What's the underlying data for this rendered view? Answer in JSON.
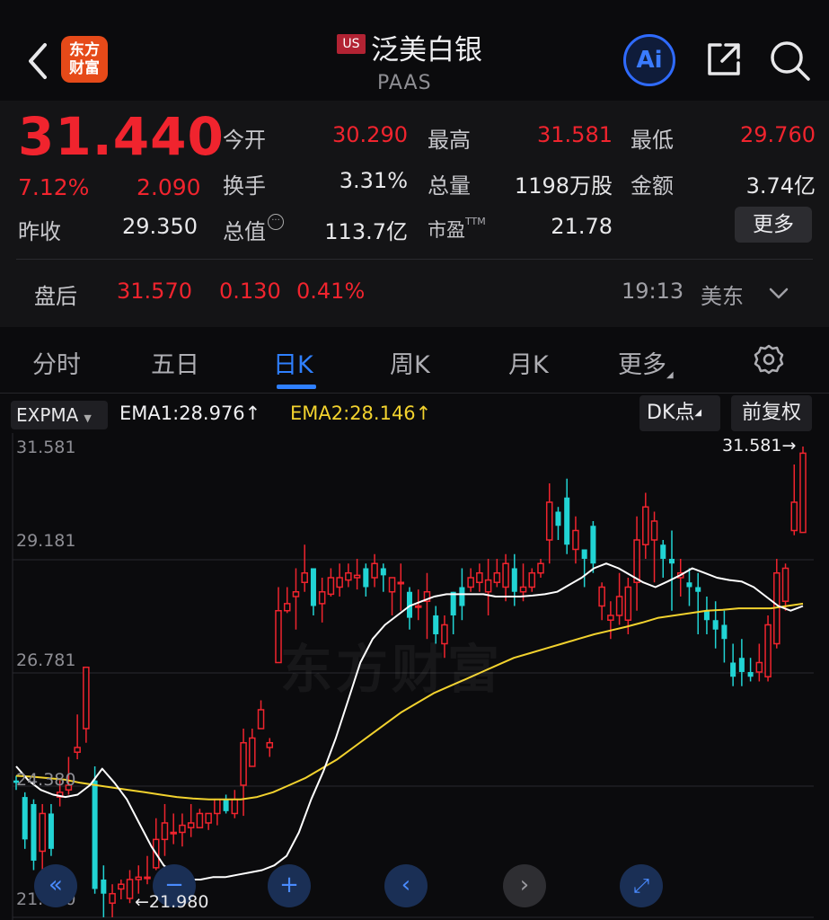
{
  "header": {
    "logo_text": "东方财富",
    "market_badge": "US",
    "stock_name": "泛美白银",
    "stock_code": "PAAS",
    "ai_label": "Ai"
  },
  "quote": {
    "price": "31.440",
    "change_pct": "7.12%",
    "change": "2.090",
    "prev_close_label": "昨收",
    "prev_close": "29.350",
    "open_label": "今开",
    "open": "30.290",
    "high_label": "最高",
    "high": "31.581",
    "low_label": "最低",
    "low": "29.760",
    "turnover_label": "换手",
    "turnover": "3.31%",
    "volume_label": "总量",
    "volume": "1198万股",
    "amount_label": "金额",
    "amount": "3.74亿",
    "mktcap_label": "总值",
    "mktcap": "113.7亿",
    "pe_label": "市盈",
    "pe_suffix": "TTM",
    "pe": "21.78",
    "more_label": "更多"
  },
  "after_hours": {
    "label": "盘后",
    "price": "31.570",
    "change": "0.130",
    "change_pct": "0.41%",
    "time": "19:13",
    "zone": "美东"
  },
  "tabs": [
    {
      "label": "分时"
    },
    {
      "label": "五日"
    },
    {
      "label": "日K"
    },
    {
      "label": "周K"
    },
    {
      "label": "月K"
    },
    {
      "label": "更多"
    }
  ],
  "indicators": {
    "selector": "EXPMA",
    "ema1": "EMA1:28.976↑",
    "ema2": "EMA2:28.146↑",
    "dk_label": "DK点",
    "adjust_label": "前复权"
  },
  "colors": {
    "up": "#f0242e",
    "down": "#21d4d4",
    "ema1": "#ffffff",
    "ema2": "#f2d22e",
    "accent": "#2f80ff"
  },
  "chart_data": {
    "type": "candlestick",
    "y_ticks": [
      "31.581",
      "29.181",
      "26.781",
      "24.380",
      "21.980"
    ],
    "ylim": [
      21.98,
      31.581
    ],
    "max_label": "31.581→",
    "min_label": "←21.980",
    "watermark": "东方财富",
    "candles": [
      [
        24.5,
        24.45,
        24.6,
        24.3
      ],
      [
        24.15,
        23.25,
        24.25,
        23.05
      ],
      [
        24.0,
        22.8,
        24.1,
        22.6
      ],
      [
        23.0,
        23.8,
        24.0,
        22.6
      ],
      [
        23.8,
        23.05,
        24.0,
        22.9
      ],
      [
        24.15,
        24.25,
        24.5,
        23.95
      ],
      [
        24.3,
        24.4,
        25.0,
        24.2
      ],
      [
        25.1,
        25.2,
        25.9,
        24.95
      ],
      [
        25.6,
        26.9,
        26.9,
        25.3
      ],
      [
        24.5,
        22.2,
        24.8,
        22.1
      ],
      [
        22.4,
        22.1,
        22.7,
        21.6
      ],
      [
        21.9,
        22.1,
        22.3,
        21.6
      ],
      [
        22.2,
        22.3,
        22.4,
        21.98
      ],
      [
        22.0,
        22.4,
        22.6,
        21.9
      ],
      [
        22.4,
        22.45,
        22.7,
        22.1
      ],
      [
        22.45,
        22.45,
        22.9,
        22.3
      ],
      [
        22.65,
        23.25,
        23.7,
        22.6
      ],
      [
        23.25,
        23.6,
        24.0,
        22.9
      ],
      [
        23.4,
        23.4,
        23.8,
        23.15
      ],
      [
        23.4,
        23.55,
        23.8,
        23.1
      ],
      [
        23.5,
        23.6,
        24.0,
        23.3
      ],
      [
        23.5,
        23.8,
        23.9,
        23.5
      ],
      [
        23.6,
        23.8,
        23.8,
        23.45
      ],
      [
        23.8,
        24.1,
        24.1,
        23.55
      ],
      [
        24.1,
        23.85,
        24.2,
        23.8
      ],
      [
        23.8,
        24.1,
        24.3,
        23.7
      ],
      [
        24.4,
        25.3,
        25.6,
        23.75
      ],
      [
        24.8,
        25.4,
        25.6,
        24.8
      ],
      [
        25.6,
        26.0,
        26.2,
        25.6
      ],
      [
        25.2,
        25.3,
        25.4,
        25.0
      ],
      [
        27.0,
        28.1,
        28.6,
        27.0
      ],
      [
        28.1,
        28.25,
        28.6,
        28.05
      ],
      [
        28.4,
        28.5,
        29.0,
        27.7
      ],
      [
        28.7,
        28.9,
        29.5,
        28.5
      ],
      [
        29.0,
        28.2,
        29.0,
        28.0
      ],
      [
        28.25,
        28.5,
        28.8,
        27.85
      ],
      [
        28.45,
        28.8,
        29.0,
        28.4
      ],
      [
        28.6,
        28.8,
        29.1,
        28.4
      ],
      [
        28.75,
        28.9,
        29.1,
        28.6
      ],
      [
        28.8,
        28.85,
        29.2,
        28.55
      ],
      [
        29.0,
        28.6,
        29.1,
        28.4
      ],
      [
        28.8,
        29.1,
        29.3,
        28.6
      ],
      [
        29.0,
        28.85,
        29.1,
        28.5
      ],
      [
        28.5,
        28.8,
        28.8,
        28.0
      ],
      [
        28.7,
        28.7,
        29.1,
        28.1
      ],
      [
        28.5,
        27.95,
        28.6,
        27.7
      ],
      [
        28.2,
        28.2,
        28.55,
        27.9
      ],
      [
        28.3,
        28.5,
        28.9,
        27.5
      ],
      [
        28.0,
        27.6,
        28.2,
        27.4
      ],
      [
        27.4,
        27.8,
        28.0,
        27.1
      ],
      [
        28.5,
        28.0,
        28.5,
        27.6
      ],
      [
        28.6,
        28.2,
        29.0,
        27.9
      ],
      [
        28.6,
        28.8,
        29.0,
        28.5
      ],
      [
        28.7,
        28.9,
        29.1,
        28.5
      ],
      [
        28.5,
        28.75,
        29.2,
        28.0
      ],
      [
        28.7,
        28.9,
        29.2,
        28.6
      ],
      [
        28.6,
        29.1,
        29.3,
        28.3
      ],
      [
        29.0,
        28.5,
        29.3,
        28.2
      ],
      [
        28.5,
        28.6,
        29.1,
        28.3
      ],
      [
        28.6,
        28.9,
        29.0,
        28.5
      ],
      [
        28.9,
        29.1,
        29.2,
        28.8
      ],
      [
        29.6,
        30.4,
        30.8,
        29.1
      ],
      [
        30.2,
        29.9,
        30.3,
        29.6
      ],
      [
        30.5,
        29.5,
        30.9,
        29.3
      ],
      [
        29.4,
        29.8,
        30.1,
        29.1
      ],
      [
        29.4,
        29.2,
        29.4,
        28.6
      ],
      [
        29.9,
        29.1,
        30.0,
        28.9
      ],
      [
        28.2,
        28.6,
        28.7,
        27.9
      ],
      [
        27.9,
        28.0,
        28.3,
        27.5
      ],
      [
        28.0,
        28.4,
        28.9,
        27.8
      ],
      [
        27.9,
        28.6,
        28.8,
        27.6
      ],
      [
        28.7,
        29.6,
        30.1,
        28.1
      ],
      [
        29.5,
        30.3,
        30.6,
        29.2
      ],
      [
        29.6,
        30.0,
        30.2,
        28.7
      ],
      [
        29.5,
        29.2,
        29.6,
        28.8
      ],
      [
        29.2,
        29.1,
        29.8,
        28.1
      ],
      [
        28.8,
        28.9,
        29.2,
        28.4
      ],
      [
        28.7,
        28.6,
        29.0,
        28.2
      ],
      [
        28.6,
        28.5,
        28.9,
        27.6
      ],
      [
        28.1,
        27.9,
        28.4,
        27.6
      ],
      [
        27.9,
        27.7,
        28.3,
        27.3
      ],
      [
        27.8,
        27.5,
        28.1,
        27.0
      ],
      [
        27.0,
        26.7,
        27.4,
        26.5
      ],
      [
        27.1,
        26.8,
        27.5,
        26.5
      ],
      [
        26.8,
        26.7,
        27.1,
        26.6
      ],
      [
        26.8,
        27.0,
        27.4,
        26.6
      ],
      [
        26.7,
        27.8,
        28.0,
        26.6
      ],
      [
        27.4,
        28.9,
        29.2,
        27.3
      ],
      [
        28.3,
        29.0,
        29.1,
        28.1
      ],
      [
        29.8,
        30.4,
        31.2,
        29.7
      ],
      [
        29.76,
        31.44,
        31.581,
        29.76
      ]
    ],
    "ema1": [
      24.8,
      24.5,
      24.3,
      24.2,
      24.15,
      24.2,
      24.4,
      24.75,
      24.45,
      24.1,
      23.6,
      23.1,
      22.7,
      22.5,
      22.4,
      22.4,
      22.45,
      22.45,
      22.5,
      22.55,
      22.6,
      22.7,
      22.9,
      23.4,
      24.1,
      24.7,
      25.4,
      26.2,
      27.0,
      27.5,
      27.8,
      28.0,
      28.2,
      28.3,
      28.4,
      28.45,
      28.45,
      28.45,
      28.45,
      28.4,
      28.4,
      28.4,
      28.42,
      28.45,
      28.5,
      28.65,
      28.8,
      29.0,
      29.1,
      29.0,
      28.85,
      28.7,
      28.6,
      28.72,
      28.85,
      29.0,
      28.9,
      28.8,
      28.75,
      28.72,
      28.6,
      28.4,
      28.2,
      28.1,
      28.2
    ],
    "ema2": [
      24.6,
      24.58,
      24.55,
      24.52,
      24.45,
      24.4,
      24.35,
      24.3,
      24.25,
      24.2,
      24.15,
      24.12,
      24.1,
      24.1,
      24.1,
      24.15,
      24.25,
      24.4,
      24.55,
      24.75,
      24.95,
      25.2,
      25.45,
      25.7,
      25.95,
      26.15,
      26.35,
      26.5,
      26.65,
      26.8,
      26.95,
      27.1,
      27.2,
      27.3,
      27.4,
      27.5,
      27.6,
      27.68,
      27.76,
      27.85,
      27.95,
      28.0,
      28.05,
      28.1,
      28.12,
      28.15,
      28.15,
      28.15,
      28.2,
      28.25
    ]
  }
}
